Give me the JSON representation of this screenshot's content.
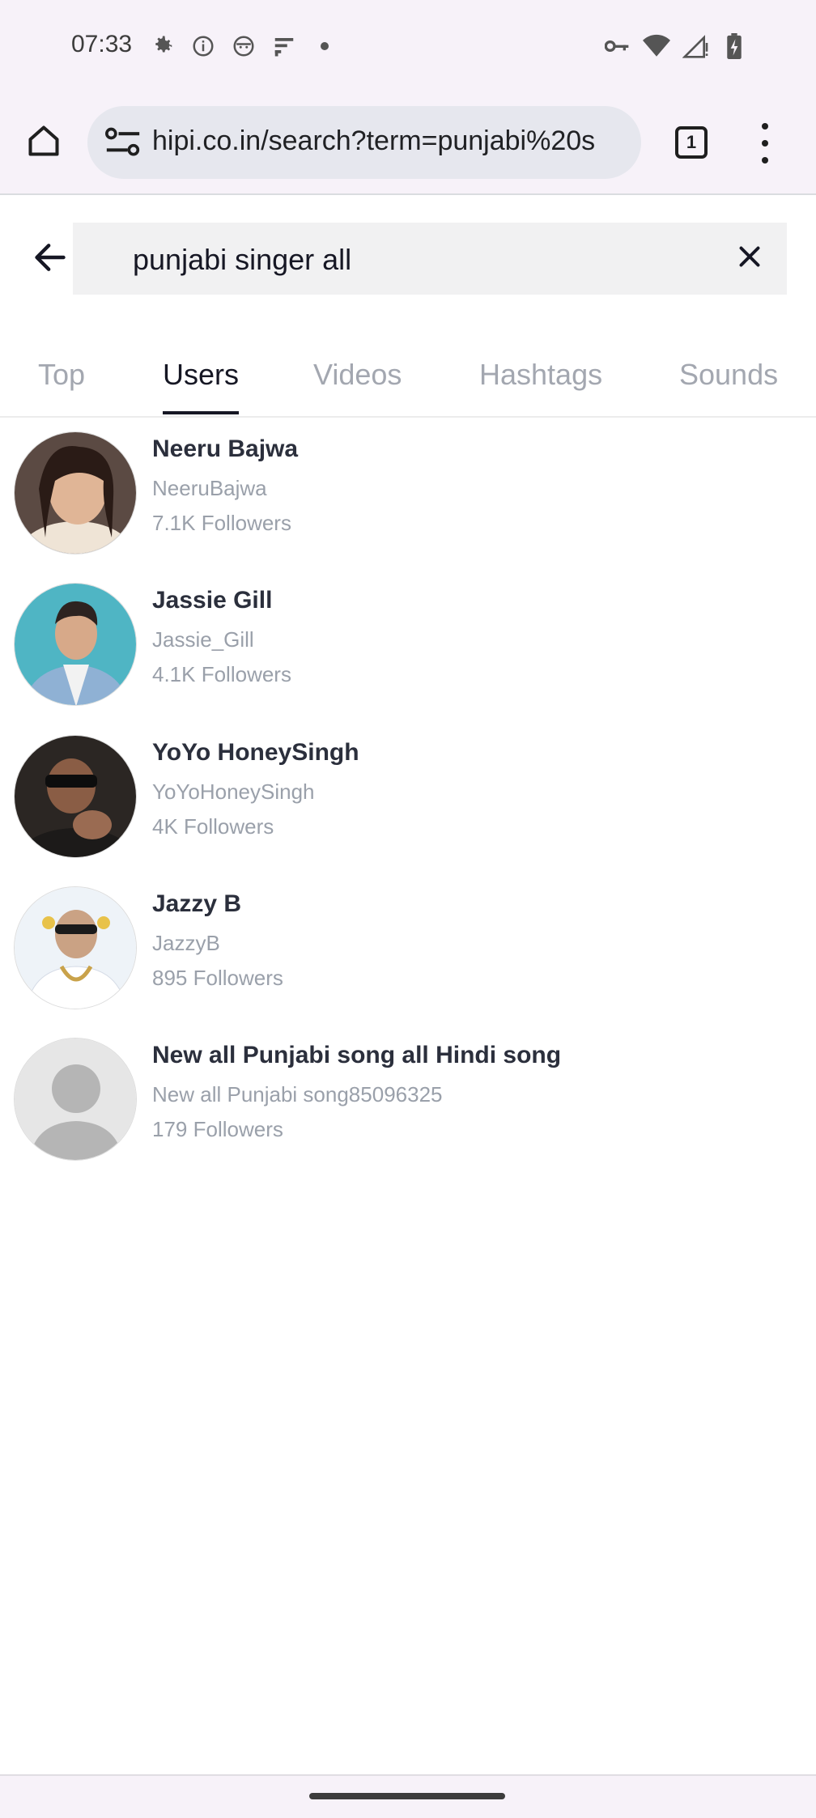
{
  "status_bar": {
    "time": "07:33",
    "left_icons": [
      "gear-icon",
      "info-icon",
      "face-icon",
      "cast-icon",
      "dot-icon"
    ],
    "right_icons": [
      "key-icon",
      "wifi-icon",
      "signal-icon",
      "battery-icon"
    ]
  },
  "browser": {
    "url": "hipi.co.in/search?term=punjabi%20s",
    "tab_count": "1"
  },
  "search": {
    "query": "punjabi singer all"
  },
  "tabs": [
    {
      "label": "Top"
    },
    {
      "label": "Users",
      "active": true
    },
    {
      "label": "Videos"
    },
    {
      "label": "Hashtags"
    },
    {
      "label": "Sounds"
    }
  ],
  "users": [
    {
      "name": "Neeru Bajwa",
      "handle": "NeeruBajwa",
      "followers": "7.1K Followers"
    },
    {
      "name": "Jassie Gill",
      "handle": "Jassie_Gill",
      "followers": "4.1K Followers"
    },
    {
      "name": "YoYo HoneySingh",
      "handle": "YoYoHoneySingh",
      "followers": "4K Followers"
    },
    {
      "name": "Jazzy B",
      "handle": "JazzyB",
      "followers": "895 Followers"
    },
    {
      "name": "New all Punjabi song all Hindi song",
      "handle": "New all Punjabi song85096325",
      "followers": "179 Followers"
    }
  ],
  "colors": {
    "active_tab": "#161724",
    "inactive_tab": "#a3a7b0",
    "secondary_text": "#9aa0aa"
  }
}
